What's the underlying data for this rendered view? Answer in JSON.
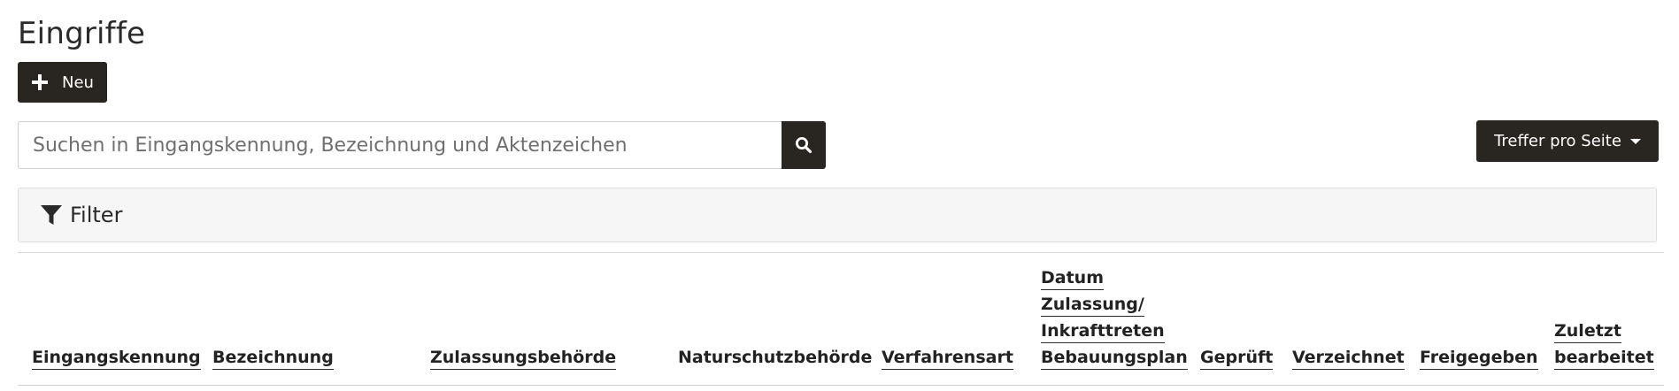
{
  "page": {
    "title": "Eingriffe"
  },
  "toolbar": {
    "new_label": "Neu"
  },
  "search": {
    "placeholder": "Suchen in Eingangskennung, Bezeichnung und Aktenzeichen",
    "value": ""
  },
  "page_size": {
    "label": "Treffer pro Seite"
  },
  "filter": {
    "label": "Filter"
  },
  "table": {
    "columns": [
      {
        "lines": [
          "Eingangskennung"
        ],
        "sortable": true
      },
      {
        "lines": [
          "Bezeichnung"
        ],
        "sortable": true
      },
      {
        "lines": [
          "Zulassungsbehörde"
        ],
        "sortable": true
      },
      {
        "lines": [
          "Naturschutzbehörde"
        ],
        "sortable": false
      },
      {
        "lines": [
          "Verfahrensart"
        ],
        "sortable": true
      },
      {
        "lines": [
          "Datum",
          "Zulassung/",
          "Inkrafttreten",
          "Bebauungsplan"
        ],
        "sortable": true
      },
      {
        "lines": [
          "Geprüft"
        ],
        "sortable": true
      },
      {
        "lines": [
          "Verzeichnet"
        ],
        "sortable": true
      },
      {
        "lines": [
          "Freigegeben"
        ],
        "sortable": true
      },
      {
        "lines": [
          "Zuletzt",
          "bearbeitet"
        ],
        "sortable": true
      }
    ]
  }
}
